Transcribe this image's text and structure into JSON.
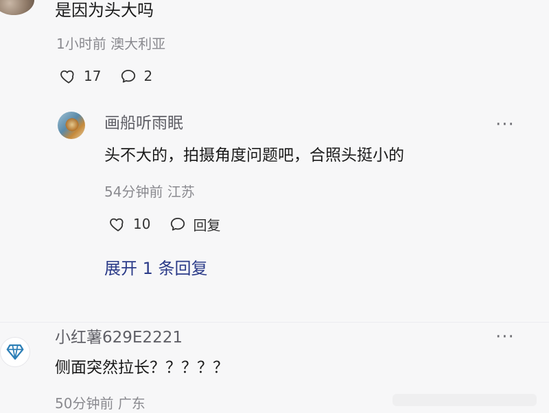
{
  "colors": {
    "background": "#f7f7f8",
    "text": "#1a1a1a",
    "meta_gray": "#8a8a8f",
    "username_gray": "#5f5f66",
    "link_blue": "#2a3a88"
  },
  "comment1": {
    "text": "是因为头大吗",
    "time": "1小时前",
    "location": "澳大利亚",
    "likes": "17",
    "replies": "2",
    "icons": {
      "like": "heart-icon",
      "reply": "comment-bubble-icon"
    }
  },
  "reply1": {
    "username": "画船听雨眠",
    "more": "···",
    "text": "头不大的，拍摄角度问题吧，合照头挺小的",
    "time": "54分钟前",
    "location": "江苏",
    "likes": "10",
    "reply_label": "回复",
    "icons": {
      "like": "heart-icon",
      "reply": "comment-bubble-icon",
      "more": "ellipsis-icon"
    }
  },
  "expand": {
    "label": "展开 1 条回复"
  },
  "comment2": {
    "username": "小红薯629E2221",
    "more": "···",
    "text": "侧面突然拉长？？？？？",
    "time": "50分钟前",
    "location": "广东",
    "icons": {
      "avatar": "diamond-icon",
      "more": "ellipsis-icon"
    }
  }
}
